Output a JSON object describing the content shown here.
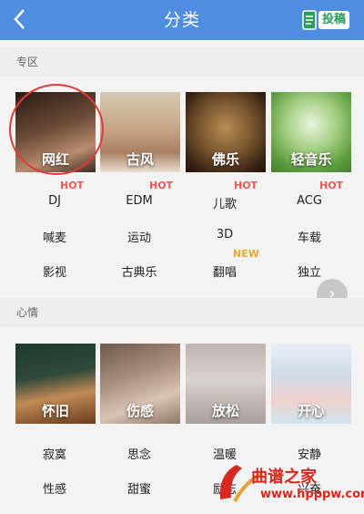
{
  "header": {
    "title": "分类",
    "submit_label": "投稿"
  },
  "sections": [
    {
      "title": "专区",
      "cards": [
        {
          "label": "网红",
          "tag": "HOT"
        },
        {
          "label": "古风",
          "tag": "HOT"
        },
        {
          "label": "佛乐",
          "tag": "HOT"
        },
        {
          "label": "轻音乐",
          "tag": "HOT"
        }
      ],
      "rows": [
        [
          "DJ",
          "EDM",
          "儿歌",
          "ACG"
        ],
        [
          "喊麦",
          "运动",
          "3D",
          "车载"
        ],
        [
          "影视",
          "古典乐",
          "翻唱",
          "独立"
        ]
      ],
      "extra_tag": "NEW"
    },
    {
      "title": "心情",
      "cards": [
        {
          "label": "怀旧"
        },
        {
          "label": "伤感"
        },
        {
          "label": "放松"
        },
        {
          "label": "开心"
        }
      ],
      "rows": [
        [
          "寂寞",
          "思念",
          "温暖",
          "安静"
        ],
        [
          "性感",
          "甜蜜",
          "励志",
          "兴奋"
        ]
      ]
    }
  ],
  "watermark": {
    "text": "曲谱之家",
    "url": "www.hpppw.com"
  },
  "colors": {
    "header": "#4f8de0",
    "hot": "#f15757",
    "new": "#e9a92a"
  }
}
